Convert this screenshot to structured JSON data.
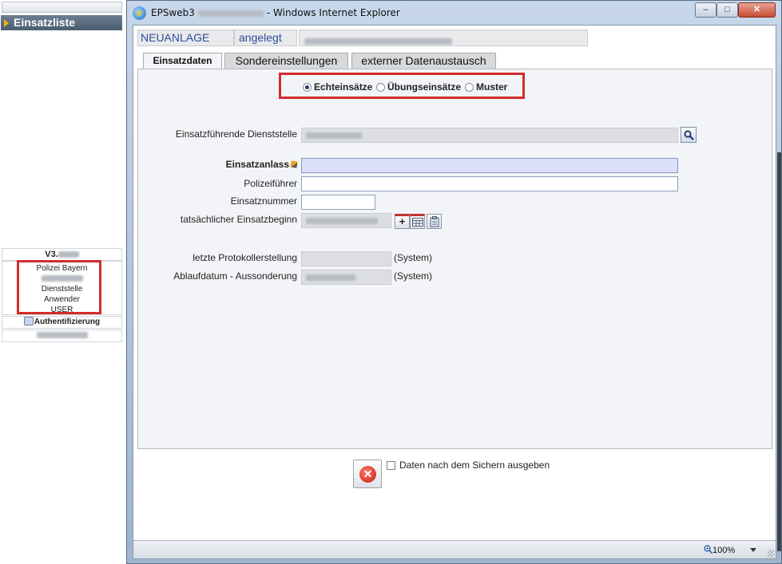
{
  "sidebar": {
    "header": "Einsatzliste",
    "version": "V3.",
    "user_info": [
      "Polizei Bayern",
      "",
      "Dienststelle",
      "Anwender",
      "USER"
    ],
    "auth_label": "Authentifizierung"
  },
  "window": {
    "title_prefix": "EPSweb3",
    "title_suffix": "- Windows Internet Explorer",
    "controls": {
      "minimize": "–",
      "maximize": "□",
      "close": "✕"
    }
  },
  "header": {
    "status": "NEUANLAGE",
    "state": "angelegt"
  },
  "tabs": [
    {
      "label": "Einsatzdaten",
      "active": true
    },
    {
      "label": "Sondereinstellungen",
      "active": false
    },
    {
      "label": "externer Datenaustausch",
      "active": false
    }
  ],
  "mode_options": [
    {
      "label": "Echteinsätze",
      "selected": true
    },
    {
      "label": "Übungseinsätze",
      "selected": false
    },
    {
      "label": "Muster",
      "selected": false
    }
  ],
  "form": {
    "dienststelle_label": "Einsatzführende Dienststelle",
    "anlass_label": "Einsatzanlass",
    "anlass_value": "",
    "polizeifuehrer_label": "Polizeiführer",
    "polizeifuehrer_value": "",
    "nummer_label": "Einsatznummer",
    "nummer_value": "",
    "beginn_label": "tatsächlicher Einsatzbeginn",
    "add_btn": "+",
    "protokoll_label": "letzte Protokollerstellung",
    "protokoll_suffix": "(System)",
    "ablauf_label": "Ablaufdatum - Aussonderung",
    "ablauf_suffix": "(System)"
  },
  "footer": {
    "cancel_icon": "✕",
    "checkbox_label": "Daten nach dem Sichern ausgeben",
    "checkbox_checked": false
  },
  "statusbar": {
    "zoom": "100%"
  },
  "colors": {
    "accent_red": "#d32c2c",
    "link_blue": "#2b4d9a",
    "required_field": "#dde0fb"
  }
}
